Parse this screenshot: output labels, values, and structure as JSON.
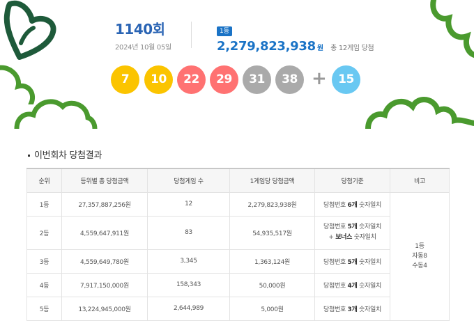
{
  "draw": {
    "round_number": "1140",
    "round_suffix": "회",
    "date": "2024년 10월 05일",
    "rank_badge": "1등",
    "first_prize_amount": "2,279,823,938",
    "first_prize_unit": "원",
    "winner_count_text": "총 12게임 당첨",
    "numbers": [
      {
        "value": "7",
        "color": "#fbc400"
      },
      {
        "value": "10",
        "color": "#fbc400"
      },
      {
        "value": "22",
        "color": "#ff7272"
      },
      {
        "value": "29",
        "color": "#ff7272"
      },
      {
        "value": "31",
        "color": "#aaaaaa"
      },
      {
        "value": "38",
        "color": "#aaaaaa"
      }
    ],
    "plus_sign": "+",
    "bonus": {
      "value": "15",
      "color": "#69c8f2"
    }
  },
  "results": {
    "section_title": "이번회차 당첨결과",
    "headers": [
      "순위",
      "등위별 총 당첨금액",
      "당첨게임 수",
      "1게임당 당첨금액",
      "당첨기준",
      "비고"
    ],
    "rows": [
      {
        "rank": "1등",
        "total": "27,357,887,256원",
        "games": "12",
        "per_game": "2,279,823,938원",
        "crit_prefix": "당첨번호 ",
        "crit_strong": "6개",
        "crit_suffix": " 숫자일치"
      },
      {
        "rank": "2등",
        "total": "4,559,647,911원",
        "games": "83",
        "per_game": "54,935,517원",
        "crit_prefix": "당첨번호 ",
        "crit_strong": "5개",
        "crit_suffix": " 숫자일치",
        "crit_line2_prefix": "+ ",
        "crit_line2_strong": "보너스",
        "crit_line2_suffix": " 숫자일치"
      },
      {
        "rank": "3등",
        "total": "4,559,649,780원",
        "games": "3,345",
        "per_game": "1,363,124원",
        "crit_prefix": "당첨번호 ",
        "crit_strong": "5개",
        "crit_suffix": " 숫자일치"
      },
      {
        "rank": "4등",
        "total": "7,917,150,000원",
        "games": "158,343",
        "per_game": "50,000원",
        "crit_prefix": "당첨번호 ",
        "crit_strong": "4개",
        "crit_suffix": " 숫자일치"
      },
      {
        "rank": "5등",
        "total": "13,224,945,000원",
        "games": "2,644,989",
        "per_game": "5,000원",
        "crit_prefix": "당첨번호 ",
        "crit_strong": "3개",
        "crit_suffix": " 숫자일치"
      }
    ],
    "note": {
      "line1": "1등",
      "line2": "자동8",
      "line3": "수동4"
    }
  },
  "colors": {
    "accent_blue": "#1a73c6",
    "round_blue": "#2a64b4",
    "deco_green": "#4a9a2e",
    "deco_dark_green": "#1e5a3a"
  },
  "icons": [
    "clover-heart-icon",
    "cloud-decoration-icon"
  ]
}
